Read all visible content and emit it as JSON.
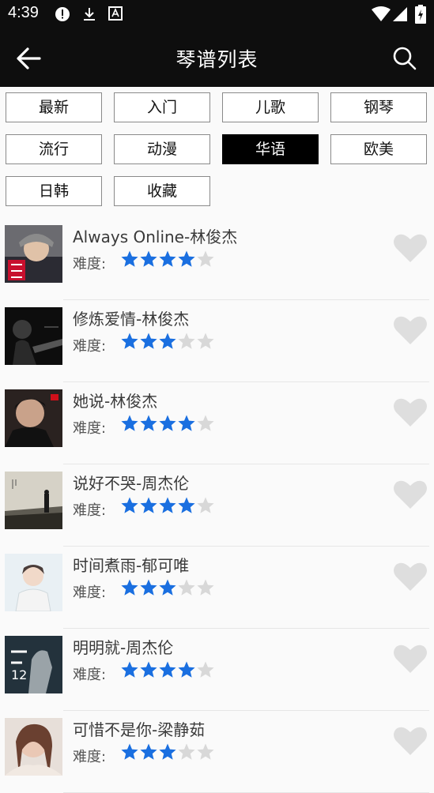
{
  "status_bar": {
    "time": "4:39"
  },
  "header": {
    "title": "琴谱列表",
    "back_icon": "arrow-left-icon",
    "search_icon": "search-icon"
  },
  "categories": [
    {
      "label": "最新",
      "active": false
    },
    {
      "label": "入门",
      "active": false
    },
    {
      "label": "儿歌",
      "active": false
    },
    {
      "label": "钢琴",
      "active": false
    },
    {
      "label": "流行",
      "active": false
    },
    {
      "label": "动漫",
      "active": false
    },
    {
      "label": "华语",
      "active": true
    },
    {
      "label": "欧美",
      "active": false
    },
    {
      "label": "日韩",
      "active": false
    },
    {
      "label": "收藏",
      "active": false
    }
  ],
  "difficulty_label": "难度:",
  "songs": [
    {
      "title": "Always Online-林俊杰",
      "stars": 4
    },
    {
      "title": "修炼爱情-林俊杰",
      "stars": 3
    },
    {
      "title": "她说-林俊杰",
      "stars": 4
    },
    {
      "title": "说好不哭-周杰伦",
      "stars": 4
    },
    {
      "title": "时间煮雨-郁可唯",
      "stars": 3
    },
    {
      "title": "明明就-周杰伦",
      "stars": 4
    },
    {
      "title": "可惜不是你-梁静茹",
      "stars": 3
    }
  ],
  "max_stars": 5,
  "colors": {
    "star_filled": "#1a6fe0",
    "star_empty": "#d8d8d8",
    "heart": "#dedede",
    "bar": "#0e0e0e"
  }
}
